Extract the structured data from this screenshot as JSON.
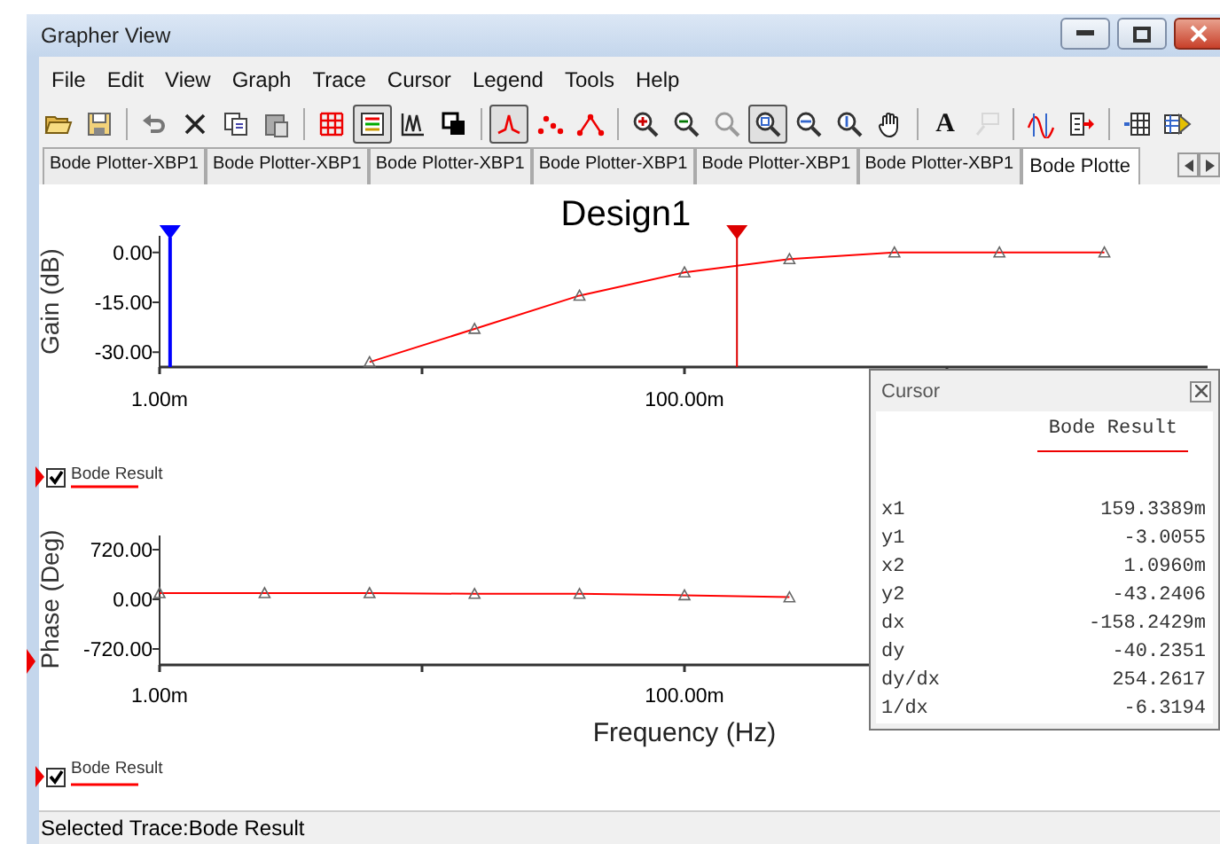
{
  "window": {
    "title": "Grapher View"
  },
  "menu": [
    "File",
    "Edit",
    "View",
    "Graph",
    "Trace",
    "Cursor",
    "Legend",
    "Tools",
    "Help"
  ],
  "toolbar": [
    {
      "kind": "open",
      "pressed": false,
      "disabled": false
    },
    {
      "kind": "save",
      "pressed": false,
      "disabled": false
    },
    {
      "kind": "separator"
    },
    {
      "kind": "undo",
      "pressed": false,
      "disabled": false
    },
    {
      "kind": "cut",
      "pressed": false,
      "disabled": false
    },
    {
      "kind": "copy",
      "pressed": false,
      "disabled": false
    },
    {
      "kind": "paste",
      "pressed": false,
      "disabled": false
    },
    {
      "kind": "separator"
    },
    {
      "kind": "grid",
      "pressed": false,
      "disabled": false
    },
    {
      "kind": "legend",
      "pressed": true,
      "disabled": false
    },
    {
      "kind": "plots",
      "pressed": false,
      "disabled": false
    },
    {
      "kind": "overlay",
      "pressed": false,
      "disabled": false
    },
    {
      "kind": "separator"
    },
    {
      "kind": "line",
      "pressed": true,
      "disabled": false
    },
    {
      "kind": "dots",
      "pressed": false,
      "disabled": false
    },
    {
      "kind": "linedots",
      "pressed": false,
      "disabled": false
    },
    {
      "kind": "separator"
    },
    {
      "kind": "zoomin",
      "pressed": false,
      "disabled": false
    },
    {
      "kind": "zoomout",
      "pressed": false,
      "disabled": false
    },
    {
      "kind": "zoomfit",
      "pressed": false,
      "disabled": true
    },
    {
      "kind": "zoombox",
      "pressed": true,
      "disabled": false
    },
    {
      "kind": "zoomx",
      "pressed": false,
      "disabled": false
    },
    {
      "kind": "zoomy",
      "pressed": false,
      "disabled": false
    },
    {
      "kind": "hand",
      "pressed": false,
      "disabled": false
    },
    {
      "kind": "separator"
    },
    {
      "kind": "text",
      "label": "A",
      "pressed": false,
      "disabled": false
    },
    {
      "kind": "label",
      "pressed": false,
      "disabled": true
    },
    {
      "kind": "separator"
    },
    {
      "kind": "cursors",
      "pressed": false,
      "disabled": false
    },
    {
      "kind": "export",
      "pressed": false,
      "disabled": false
    },
    {
      "kind": "separator"
    },
    {
      "kind": "gridexport",
      "pressed": false,
      "disabled": false
    },
    {
      "kind": "sheetexport",
      "pressed": false,
      "disabled": false
    }
  ],
  "tabs": [
    {
      "label": "Bode Plotter-XBP1",
      "selected": false
    },
    {
      "label": "Bode Plotter-XBP1",
      "selected": false
    },
    {
      "label": "Bode Plotter-XBP1",
      "selected": false
    },
    {
      "label": "Bode Plotter-XBP1",
      "selected": false
    },
    {
      "label": "Bode Plotter-XBP1",
      "selected": false
    },
    {
      "label": "Bode Plotter-XBP1",
      "selected": false
    },
    {
      "label": "Bode Plotte",
      "selected": true
    }
  ],
  "gain_plot": {
    "legend": {
      "checked": true,
      "selected": true
    },
    "cursors": [
      {
        "color": "#0000ff"
      },
      {
        "color": "#dd0000"
      }
    ],
    "chart_data": {
      "type": "line",
      "title": "Design1",
      "ylabel": "Gain (dB)",
      "ylim": [
        -34.5,
        5
      ],
      "categories": [
        "1.00m",
        null,
        null,
        null,
        null,
        "100.00m",
        null,
        null,
        null,
        null
      ],
      "yticks": [
        {
          "value": 0,
          "label": "0.00"
        },
        {
          "value": -15,
          "label": "-15.00"
        },
        {
          "value": -30,
          "label": "-30.00"
        }
      ],
      "series": [
        {
          "name": "Bode Result",
          "color": "#ff0000",
          "marker": "triangle",
          "values": [
            null,
            null,
            -33,
            -23,
            -13,
            -6,
            -2,
            0,
            0,
            0
          ]
        }
      ]
    }
  },
  "phase_plot": {
    "selected": true,
    "legend": {
      "checked": true,
      "selected": true
    },
    "chart_data": {
      "type": "line",
      "xlabel": "Frequency (Hz)",
      "ylabel": "Phase (Deg)",
      "ylim": [
        -950,
        925
      ],
      "categories": [
        "1.00m",
        null,
        null,
        null,
        null,
        "100.00m",
        null,
        null,
        null,
        null
      ],
      "yticks": [
        {
          "value": 720,
          "label": "720.00"
        },
        {
          "value": 0,
          "label": "0.00"
        },
        {
          "value": -720,
          "label": "-720.00"
        }
      ],
      "series": [
        {
          "name": "Bode Result",
          "color": "#ff0000",
          "marker": "triangle",
          "values": [
            90,
            90,
            90,
            80,
            80,
            60,
            30,
            null,
            null,
            null
          ]
        }
      ]
    }
  },
  "cursor_panel": {
    "title": "Cursor",
    "trace": "Bode Result",
    "rows": [
      {
        "label": "x1",
        "value": "159.3389m"
      },
      {
        "label": "y1",
        "value": "-3.0055"
      },
      {
        "label": "x2",
        "value": "1.0960m"
      },
      {
        "label": "y2",
        "value": "-43.2406"
      },
      {
        "label": "dx",
        "value": "-158.2429m"
      },
      {
        "label": "dy",
        "value": "-40.2351"
      },
      {
        "label": "dy/dx",
        "value": "254.2617"
      },
      {
        "label": "1/dx",
        "value": "-6.3194"
      }
    ]
  },
  "status_bar": "Selected Trace:Bode Result"
}
